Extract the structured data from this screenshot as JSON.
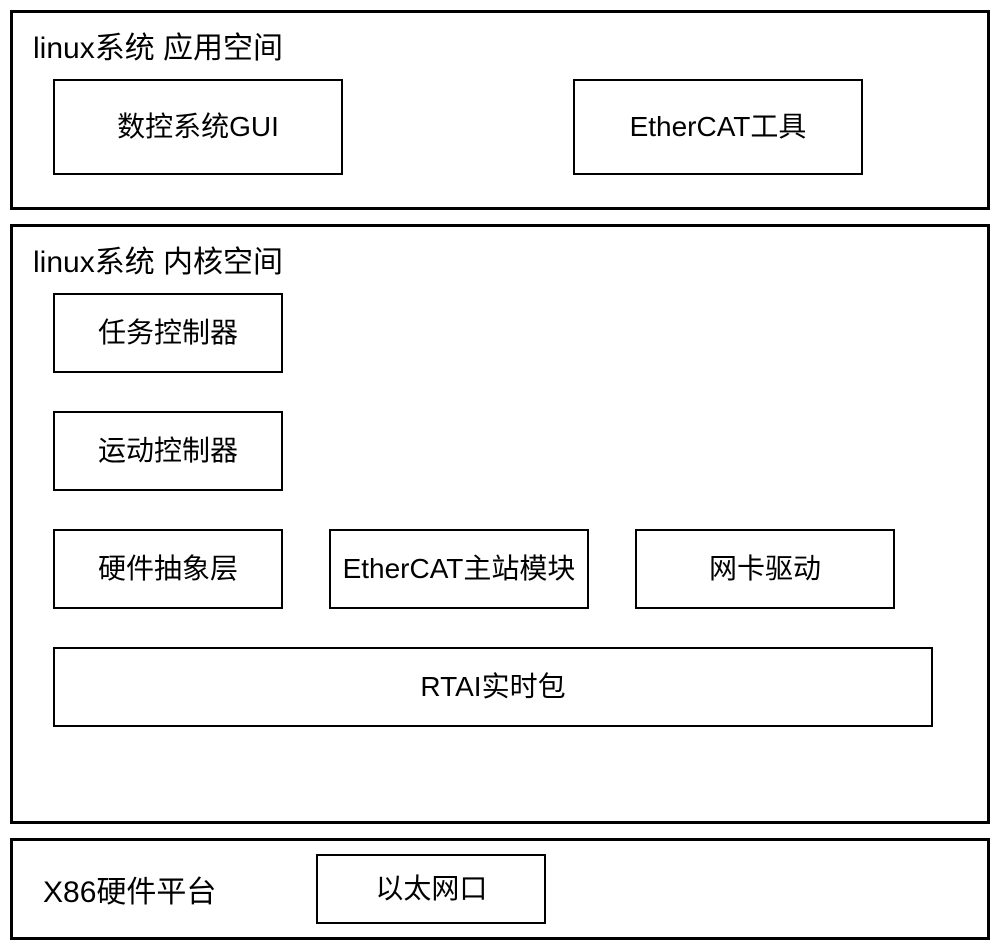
{
  "sections": {
    "user_space": {
      "title": "linux系统 应用空间",
      "boxes": {
        "gui": "数控系统GUI",
        "ethercat_tool": "EtherCAT工具"
      }
    },
    "kernel_space": {
      "title": "linux系统 内核空间",
      "boxes": {
        "task_controller": "任务控制器",
        "motion_controller": "运动控制器",
        "hal": "硬件抽象层",
        "ethercat_master": "EtherCAT主站模块",
        "nic_driver": "网卡驱动",
        "rtai": "RTAI实时包"
      }
    },
    "hw_platform": {
      "title": "X86硬件平台",
      "boxes": {
        "eth_port": "以太网口"
      }
    }
  }
}
